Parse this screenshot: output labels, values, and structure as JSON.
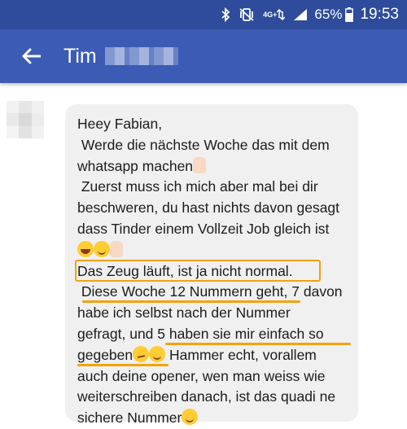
{
  "status_bar": {
    "network_label": "4G+",
    "battery_percent": "65%",
    "time": "19:53",
    "icons": [
      "bluetooth-icon",
      "vibrate-icon",
      "mobile-data-icon",
      "signal-icon",
      "battery-icon"
    ]
  },
  "header": {
    "contact_name": "Tim",
    "back_icon": "arrow-back-icon",
    "background": "#3b5bb5"
  },
  "message": {
    "bubble_color": "#f0f0f0",
    "highlight_color": "#f4a20c",
    "lines": [
      "Heey Fabian,",
      " Werde die nächste Woche das mit dem",
      "whatsapp machen",
      " Zuerst muss ich mich aber mal bei dir",
      "beschweren, du hast nichts davon gesagt",
      "dass Tinder einem Vollzeit Job gleich ist",
      "",
      "Das Zeug läuft, ist ja nicht normal.",
      " Diese Woche 12 Nummern geht, 7 davon",
      "habe ich selbst nach der Nummer",
      "gefragt, und 5 haben sie mir einfach so",
      "gegeben",
      " Hammer echt, vorallem",
      "auch deine opener, wen man weiss wie",
      "weiterschreiben danach, ist das quadi ne",
      "sichere Nummer"
    ]
  }
}
